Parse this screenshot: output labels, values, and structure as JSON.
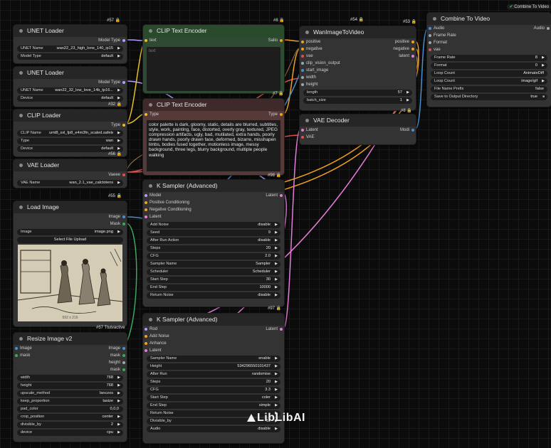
{
  "top_pill": {
    "icon": "check-circle-icon",
    "label": "Combine To Video"
  },
  "watermark": "LibLibAI",
  "badges": {
    "unet1": "#57",
    "clip_enc1": "#8",
    "wan_i2v_a": "#54",
    "wan_i2v_b": "#53",
    "unet2": "#32",
    "clip_loader": "#56",
    "clip_enc2_top": "#7",
    "clip_enc2": "#98",
    "wan_bottom": "#8",
    "vae_loader": "#55",
    "ksampler1": "#97",
    "load_image": "#57 Ttutvactive"
  },
  "unet1": {
    "title": "UNET Loader",
    "out": "Model Type",
    "widgets": [
      {
        "label": "UNET Name",
        "value": "wan22_23_high_lone_140_ip15"
      },
      {
        "label": "Model Type",
        "value": "default"
      }
    ]
  },
  "unet2": {
    "title": "UNET Loader",
    "out": "Model Type",
    "widgets": [
      {
        "label": "UNET Name",
        "value": "wan22_32_low_love_14b_tp16..."
      },
      {
        "label": "Device",
        "value": "default"
      }
    ]
  },
  "clip_loader": {
    "title": "CLIP Loader",
    "out": "Type",
    "widgets": [
      {
        "label": "CLIP Name",
        "value": "umt8_xxl_fp8_e4m3fn_scaled.safetensors sel."
      },
      {
        "label": "Type",
        "value": "wan"
      },
      {
        "label": "Device",
        "value": "default"
      }
    ]
  },
  "vae_loader": {
    "title": "VAE Loader",
    "out": "Vaeee",
    "widgets": [
      {
        "label": "VAE Name",
        "value": "wan_2.1_vae_calctotens"
      }
    ]
  },
  "load_image": {
    "title": "Load Image",
    "outs": [
      "Image",
      "Mask"
    ],
    "widgets": [
      {
        "label": "Image",
        "value": "image.png"
      }
    ],
    "upload": "Select File Upload",
    "caption": "592 x 216"
  },
  "resize": {
    "title": "Resize Image v2",
    "ins": [
      "Image",
      "mask"
    ],
    "outs": [
      "Image",
      "mask",
      "height",
      "mask"
    ],
    "widgets": [
      {
        "label": "width",
        "value": "768"
      },
      {
        "label": "height",
        "value": "768"
      },
      {
        "label": "upscale_method",
        "value": "lanczos"
      },
      {
        "label": "keep_proportion",
        "value": "tasize"
      },
      {
        "label": "pad_color",
        "value": "0,0,0"
      },
      {
        "label": "crop_position",
        "value": "center"
      },
      {
        "label": "divisible_by",
        "value": "2"
      },
      {
        "label": "device",
        "value": "cpu"
      }
    ]
  },
  "clip_enc1": {
    "title": "CLIP Text Encoder",
    "in": "text",
    "out": "Salio",
    "placeholder": "text"
  },
  "clip_enc2": {
    "title": "CLIP Text Encoder",
    "in": "Type",
    "out": "Type",
    "prompt": "color palette is dark, gloomy, static, details are blurred, subtitles, style, work, painting, face, distorted, overly gray, textured, JPEG compression artifacts, ugly, bad, mutilated, extra hands, poorly drawn hands, poorly drawn face, deformed, bizarre, misshapen limbs, bodies fused together, motionless image, messy background, three legs, blurry background, multiple people walking"
  },
  "wan_i2v": {
    "title": "WanImageToVideo",
    "ins": [
      "positive",
      "negative",
      "vae",
      "clip_vision_output",
      "start_image",
      "width",
      "height"
    ],
    "outs": [
      "positive",
      "negative",
      "latent"
    ],
    "widgets": [
      {
        "label": "length",
        "value": "57"
      },
      {
        "label": "batch_size",
        "value": "1"
      }
    ]
  },
  "vae_decoder": {
    "title": "VAE Decoder",
    "ins": [
      "Latent",
      "VAE"
    ],
    "out": "Modi"
  },
  "combine": {
    "title": "Combine To Video",
    "ins": [
      "Audio",
      "Frame Rate",
      "Format",
      "vae"
    ],
    "out": "Audio",
    "widgets": [
      {
        "label": "Frame Rate",
        "value": "8"
      },
      {
        "label": "Format",
        "value": "0"
      },
      {
        "label": "Loop Count",
        "value": "AnimateDiff"
      },
      {
        "label": "Loop Count",
        "value": "image/gif"
      },
      {
        "label": "File Name Prefix",
        "value": "false"
      },
      {
        "label": "Save to Output Directory",
        "value": "true"
      }
    ]
  },
  "ksampler1": {
    "title": "K Sampler (Advanced)",
    "ins": [
      "Model",
      "Positive Conditioning",
      "Negative Conditioning",
      "Latent"
    ],
    "out": "Latent",
    "widgets": [
      {
        "label": "Add Noise",
        "value": "disable"
      },
      {
        "label": "Seed",
        "value": "9"
      },
      {
        "label": "After Run Action",
        "value": "disable"
      },
      {
        "label": "Steps",
        "value": "20"
      },
      {
        "label": "CFG",
        "value": "2.0"
      },
      {
        "label": "Sampler Name",
        "value": "Sampler"
      },
      {
        "label": "Scheduler",
        "value": "Scheduler"
      },
      {
        "label": "Start Step",
        "value": "30"
      },
      {
        "label": "End Step",
        "value": "10000"
      },
      {
        "label": "Return Noise",
        "value": "disable"
      }
    ]
  },
  "ksampler2": {
    "title": "K Sampler (Advanced)",
    "ins": [
      "Rod",
      "Add Noise",
      "Anhance",
      "Latent"
    ],
    "out": "Latent",
    "widgets": [
      {
        "label": "Sampler Name",
        "value": "enable"
      },
      {
        "label": "Height",
        "value": "534296550101437"
      },
      {
        "label": "After Run",
        "value": "randomise"
      },
      {
        "label": "Steps",
        "value": "20"
      },
      {
        "label": "CFG",
        "value": "3.3"
      },
      {
        "label": "Start Step",
        "value": "coler"
      },
      {
        "label": "End Step",
        "value": "simple"
      },
      {
        "label": "Return Noise",
        "value": ""
      },
      {
        "label": "Divisible_by",
        "value": "12"
      },
      {
        "label": "Audio",
        "value": "disable"
      }
    ]
  }
}
